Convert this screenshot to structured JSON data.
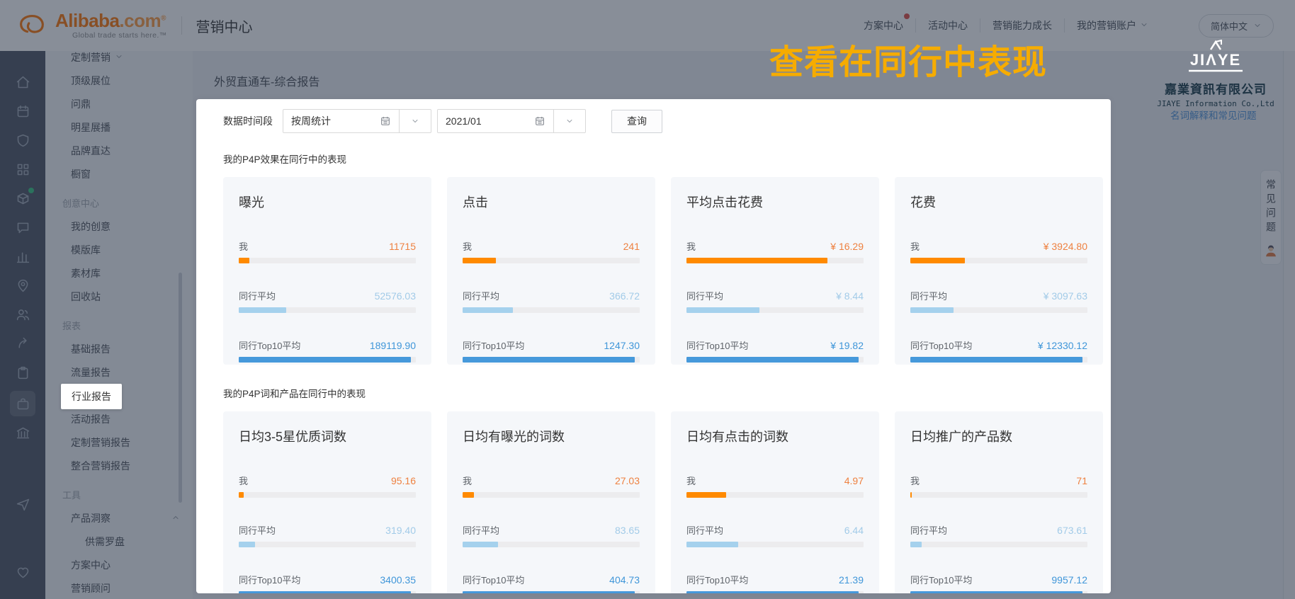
{
  "header": {
    "logo": {
      "brand": "Alibaba",
      "dotcom": ".com",
      "reg": "®",
      "tagline": "Global trade starts here.™"
    },
    "app_title": "营销中心",
    "nav": [
      {
        "label": "方案中心",
        "badge": true
      },
      {
        "label": "活动中心"
      },
      {
        "label": "营销能力成长"
      },
      {
        "label": "我的营销账户",
        "chevron": true
      }
    ],
    "language": {
      "label": "简体中文"
    }
  },
  "icon_rail": {
    "icons": [
      {
        "name": "home-icon"
      },
      {
        "name": "calendar-icon"
      },
      {
        "name": "shield-icon"
      },
      {
        "name": "apps-icon"
      },
      {
        "name": "box-icon",
        "dot": true
      },
      {
        "name": "chat-icon"
      },
      {
        "name": "bar-chart-icon"
      },
      {
        "name": "location-icon"
      },
      {
        "name": "users-icon"
      },
      {
        "name": "share-icon"
      },
      {
        "name": "clipboard-icon"
      },
      {
        "name": "briefcase-icon",
        "active": true
      },
      {
        "name": "bank-icon"
      },
      {
        "name": "send-icon",
        "gap": true
      },
      {
        "name": "heart-icon",
        "bottom": true
      }
    ]
  },
  "sidebar": {
    "items": [
      {
        "type": "item",
        "label": "定制营销",
        "chevron_inline": true,
        "first": true
      },
      {
        "type": "item",
        "label": "顶级展位"
      },
      {
        "type": "item",
        "label": "问鼎"
      },
      {
        "type": "item",
        "label": "明星展播"
      },
      {
        "type": "item",
        "label": "品牌直达"
      },
      {
        "type": "item",
        "label": "橱窗"
      },
      {
        "type": "section",
        "label": "创意中心"
      },
      {
        "type": "item",
        "label": "我的创意"
      },
      {
        "type": "item",
        "label": "模版库"
      },
      {
        "type": "item",
        "label": "素材库"
      },
      {
        "type": "item",
        "label": "回收站"
      },
      {
        "type": "section",
        "label": "报表"
      },
      {
        "type": "item",
        "label": "基础报告"
      },
      {
        "type": "item",
        "label": "流量报告"
      },
      {
        "type": "item",
        "label": "行业报告",
        "active": true
      },
      {
        "type": "item",
        "label": "活动报告"
      },
      {
        "type": "item",
        "label": "定制营销报告"
      },
      {
        "type": "item",
        "label": "整合营销报告"
      },
      {
        "type": "section",
        "label": "工具"
      },
      {
        "type": "item",
        "label": "产品洞察",
        "expanded": true
      },
      {
        "type": "subitem",
        "label": "供需罗盘"
      },
      {
        "type": "item",
        "label": "方案中心"
      },
      {
        "type": "item",
        "label": "营销顾问"
      }
    ]
  },
  "main": {
    "page_title": "外贸直通车-综合报告",
    "filters": {
      "label": "数据时间段",
      "period_value": "按周统计",
      "month_value": "2021/01",
      "query_label": "查询"
    },
    "glossary_link": "名词解释和常见问题",
    "faq_tab": "常见问题"
  },
  "chart_data": [
    {
      "type": "bar",
      "title": "我的P4P效果在同行中的表现",
      "row_labels": [
        "我",
        "同行平均",
        "同行Top10平均"
      ],
      "cards": [
        {
          "title": "曝光",
          "rows": [
            {
              "label": "我",
              "value": 11715,
              "display": "11715"
            },
            {
              "label": "同行平均",
              "value": 52576.03,
              "display": "52576.03"
            },
            {
              "label": "同行Top10平均",
              "value": 189119.9,
              "display": "189119.90"
            }
          ]
        },
        {
          "title": "点击",
          "rows": [
            {
              "label": "我",
              "value": 241,
              "display": "241"
            },
            {
              "label": "同行平均",
              "value": 366.72,
              "display": "366.72"
            },
            {
              "label": "同行Top10平均",
              "value": 1247.3,
              "display": "1247.30"
            }
          ]
        },
        {
          "title": "平均点击花费",
          "rows": [
            {
              "label": "我",
              "value": 16.29,
              "display": "¥ 16.29"
            },
            {
              "label": "同行平均",
              "value": 8.44,
              "display": "¥ 8.44"
            },
            {
              "label": "同行Top10平均",
              "value": 19.82,
              "display": "¥ 19.82"
            }
          ]
        },
        {
          "title": "花费",
          "rows": [
            {
              "label": "我",
              "value": 3924.8,
              "display": "¥ 3924.80"
            },
            {
              "label": "同行平均",
              "value": 3097.63,
              "display": "¥ 3097.63"
            },
            {
              "label": "同行Top10平均",
              "value": 12330.12,
              "display": "¥ 12330.12"
            }
          ]
        }
      ]
    },
    {
      "type": "bar",
      "title": "我的P4P词和产品在同行中的表现",
      "row_labels": [
        "我",
        "同行平均",
        "同行Top10平均"
      ],
      "cards": [
        {
          "title": "日均3-5星优质词数",
          "rows": [
            {
              "label": "我",
              "value": 95.16,
              "display": "95.16"
            },
            {
              "label": "同行平均",
              "value": 319.4,
              "display": "319.40"
            },
            {
              "label": "同行Top10平均",
              "value": 3400.35,
              "display": "3400.35"
            }
          ]
        },
        {
          "title": "日均有曝光的词数",
          "rows": [
            {
              "label": "我",
              "value": 27.03,
              "display": "27.03"
            },
            {
              "label": "同行平均",
              "value": 83.65,
              "display": "83.65"
            },
            {
              "label": "同行Top10平均",
              "value": 404.73,
              "display": "404.73"
            }
          ]
        },
        {
          "title": "日均有点击的词数",
          "rows": [
            {
              "label": "我",
              "value": 4.97,
              "display": "4.97"
            },
            {
              "label": "同行平均",
              "value": 6.44,
              "display": "6.44"
            },
            {
              "label": "同行Top10平均",
              "value": 21.39,
              "display": "21.39"
            }
          ]
        },
        {
          "title": "日均推广的产品数",
          "rows": [
            {
              "label": "我",
              "value": 71,
              "display": "71"
            },
            {
              "label": "同行平均",
              "value": 673.61,
              "display": "673.61"
            },
            {
              "label": "同行Top10平均",
              "value": 9957.12,
              "display": "9957.12"
            }
          ]
        }
      ]
    }
  ],
  "colors": {
    "me_bar": "#ff8a00",
    "me_text": "#ee8140",
    "peer_bar": "#a5d1ed",
    "peer_text": "#a2cbe8",
    "top10_bar": "#4699db",
    "top10_text": "#3f96d9",
    "tour_yellow": "#f6ac00",
    "brand_orange": "#ff7300",
    "link_blue": "#4a90d9",
    "badge_red": "#e04a42"
  },
  "overlay": {
    "headline": "查看在同行中表现",
    "watermark": {
      "logo_text": "JIΛYE",
      "company_zh": "嘉業資訊有限公司",
      "company_en": "JIAYE Information Co.,Ltd"
    }
  }
}
